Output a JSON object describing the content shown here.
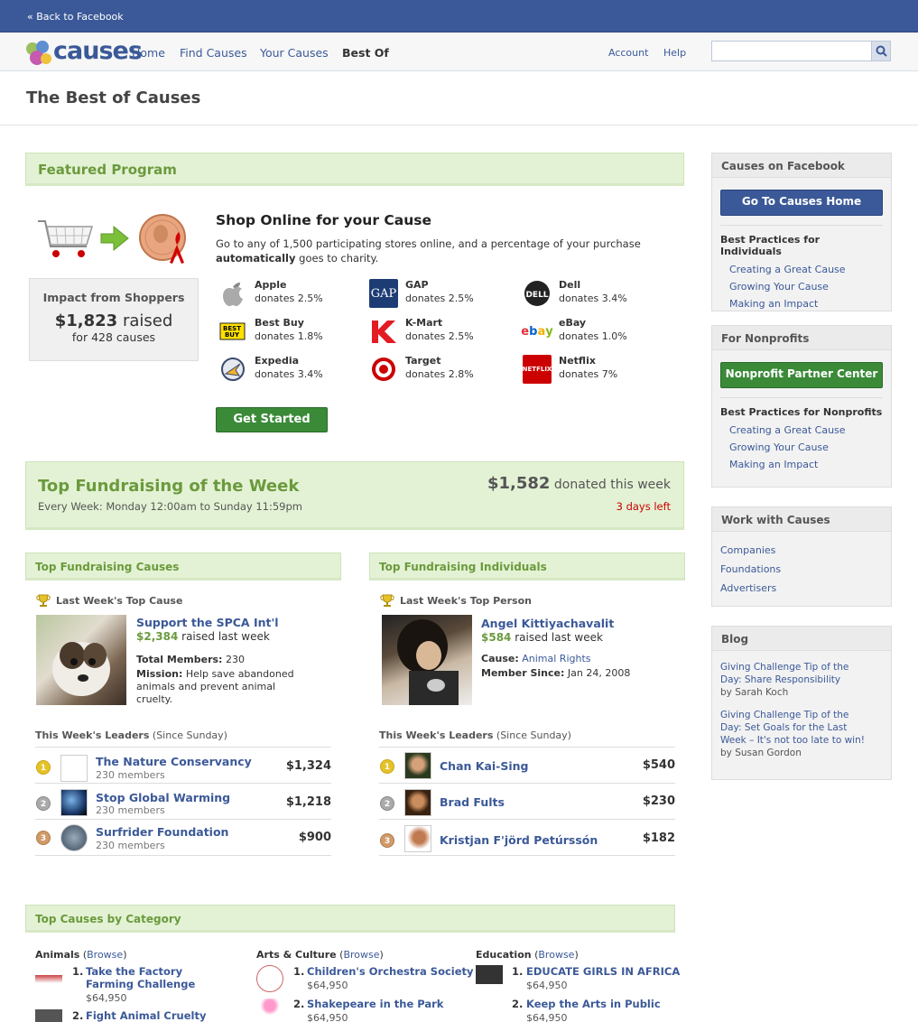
{
  "topbar": {
    "back_link": "« Back to Facebook"
  },
  "nav": {
    "logo_text": "causes",
    "links": [
      "Home",
      "Find Causes",
      "Your Causes",
      "Best Of"
    ],
    "account": "Account",
    "help": "Help",
    "search_placeholder": ""
  },
  "page_title": "The Best of Causes",
  "featured": {
    "heading": "Featured Program",
    "shop_title": "Shop Online for your Cause",
    "shop_desc_1": "Go to any of 1,500 participating stores online, and a percentage of your purchase",
    "shop_desc_bold": "automatically",
    "shop_desc_2": "goes to charity.",
    "impact_title": "Impact from Shoppers",
    "impact_amount": "$1,823",
    "impact_raised": "raised",
    "impact_causes": "for 428 causes",
    "get_started": "Get Started",
    "stores": [
      {
        "name": "Apple",
        "donates": "donates 2.5%",
        "icon": "apple-logo"
      },
      {
        "name": "GAP",
        "donates": "donates 2.5%",
        "icon": "gap-logo"
      },
      {
        "name": "Dell",
        "donates": "donates 3.4%",
        "icon": "dell-logo"
      },
      {
        "name": "Best Buy",
        "donates": "donates 1.8%",
        "icon": "bestbuy-logo"
      },
      {
        "name": "K-Mart",
        "donates": "donates 2.5%",
        "icon": "kmart-logo"
      },
      {
        "name": "eBay",
        "donates": "donates 1.0%",
        "icon": "ebay-logo"
      },
      {
        "name": "Expedia",
        "donates": "donates 3.4%",
        "icon": "expedia-logo"
      },
      {
        "name": "Target",
        "donates": "donates 2.8%",
        "icon": "target-logo"
      },
      {
        "name": "Netflix",
        "donates": "donates 7%",
        "icon": "netflix-logo"
      }
    ]
  },
  "week": {
    "title": "Top Fundraising of the Week",
    "schedule": "Every Week: Monday 12:00am to Sunday 11:59pm",
    "amount": "$1,582",
    "amount_suffix": "donated this week",
    "days_left": "3 days left"
  },
  "causes": {
    "heading": "Top Fundraising Causes",
    "last_week_label": "Last Week's Top Cause",
    "top_name": "Support the SPCA Int'l",
    "top_amount": "$2,384",
    "top_raised": "raised last week",
    "members_label": "Total Members:",
    "members_value": "230",
    "mission_label": "Mission:",
    "mission_value": "Help save abandoned animals and prevent animal cruelty.",
    "leaders_label": "This Week's Leaders",
    "leaders_since": "(Since Sunday)",
    "leaders": [
      {
        "rank": "1",
        "name": "The Nature Conservancy",
        "members": "230 members",
        "amount": "$1,324"
      },
      {
        "rank": "2",
        "name": "Stop Global Warming",
        "members": "230 members",
        "amount": "$1,218"
      },
      {
        "rank": "3",
        "name": "Surfrider Foundation",
        "members": "230 members",
        "amount": "$900"
      }
    ]
  },
  "individuals": {
    "heading": "Top Fundraising Individuals",
    "last_week_label": "Last Week's Top Person",
    "top_name": "Angel Kittiyachavalit",
    "top_amount": "$584",
    "top_raised": "raised last week",
    "cause_label": "Cause:",
    "cause_value": "Animal Rights",
    "since_label": "Member Since:",
    "since_value": "Jan 24, 2008",
    "leaders_label": "This Week's Leaders",
    "leaders_since": "(Since Sunday)",
    "leaders": [
      {
        "rank": "1",
        "name": "Chan Kai-Sing",
        "amount": "$540"
      },
      {
        "rank": "2",
        "name": "Brad Fults",
        "amount": "$230"
      },
      {
        "rank": "3",
        "name": "Kristjan F'jörd Petúrssón",
        "amount": "$182"
      }
    ]
  },
  "categories": {
    "heading": "Top Causes by Category",
    "browse": "Browse",
    "columns": [
      {
        "name": "Animals",
        "items": [
          {
            "rank": "1.",
            "title": "Take the Factory Farming Challenge",
            "amount": "$64,950"
          },
          {
            "rank": "2.",
            "title": "Fight Animal Cruelty",
            "amount": ""
          }
        ]
      },
      {
        "name": "Arts & Culture",
        "items": [
          {
            "rank": "1.",
            "title": "Children's Orchestra Society",
            "amount": "$64,950"
          },
          {
            "rank": "2.",
            "title": "Shakepeare in the Park",
            "amount": "$64,950"
          }
        ]
      },
      {
        "name": "Education",
        "items": [
          {
            "rank": "1.",
            "title": "EDUCATE GIRLS IN AFRICA",
            "amount": "$64,950"
          },
          {
            "rank": "2.",
            "title": "Keep the Arts in Public",
            "amount": "$64,950"
          }
        ]
      }
    ]
  },
  "sidebar": {
    "fb": {
      "heading": "Causes on Facebook",
      "button": "Go To Causes Home",
      "subtitle": "Best Practices for Individuals",
      "links": [
        "Creating a Great Cause",
        "Growing Your Cause",
        "Making an Impact"
      ]
    },
    "np": {
      "heading": "For Nonprofits",
      "button": "Nonprofit Partner Center",
      "subtitle": "Best Practices for Nonprofits",
      "links": [
        "Creating a Great Cause",
        "Growing Your Cause",
        "Making an Impact"
      ]
    },
    "work": {
      "heading": "Work with Causes",
      "links": [
        "Companies",
        "Foundations",
        "Advertisers"
      ]
    },
    "blog": {
      "heading": "Blog",
      "posts": [
        {
          "title": "Giving Challenge Tip of the Day: Share Responsibility",
          "author": "by Sarah Koch"
        },
        {
          "title": "Giving Challenge Tip of the Day: Set Goals for the Last Week – It's not too late to win!",
          "author": "by Susan Gordon"
        }
      ]
    }
  },
  "colors": {
    "brand": "#3b5998",
    "green": "#6b9a3d",
    "alert": "#cc0000"
  }
}
